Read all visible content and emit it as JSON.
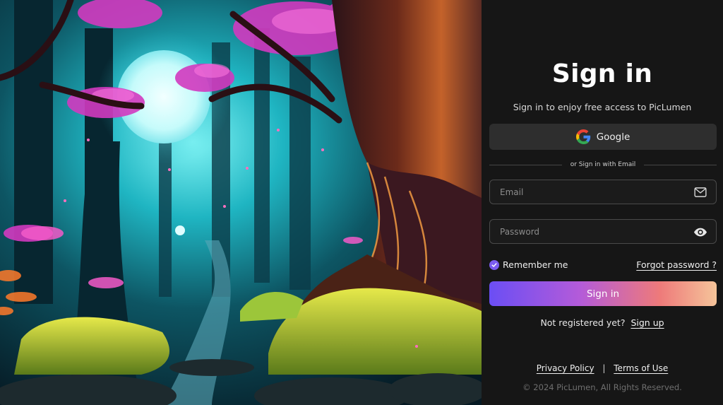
{
  "auth": {
    "title": "Sign in",
    "subtitle": "Sign in to enjoy free access to PicLumen",
    "google_label": "Google",
    "divider_text": "or Sign in with Email",
    "email": {
      "placeholder": "Email",
      "value": ""
    },
    "password": {
      "placeholder": "Password",
      "value": ""
    },
    "remember_label": "Remember me",
    "remember_checked": true,
    "forgot_label": "Forgot password ?",
    "signin_label": "Sign in",
    "register_prompt": "Not registered yet?",
    "register_link": "Sign up"
  },
  "footer": {
    "privacy": "Privacy Policy",
    "separator": "|",
    "terms": "Terms of Use",
    "copyright": "© 2024 PicLumen, All Rights Reserved."
  },
  "icons": {
    "google": "google-logo-icon",
    "email": "mail-icon",
    "password": "eye-icon",
    "remember": "check-icon"
  },
  "colors": {
    "panel_bg": "#161616",
    "button_bg": "#2e2e2e",
    "accent": "#7b5cf0",
    "gradient_start": "#6b4ef4",
    "gradient_end": "#f5c49a"
  }
}
